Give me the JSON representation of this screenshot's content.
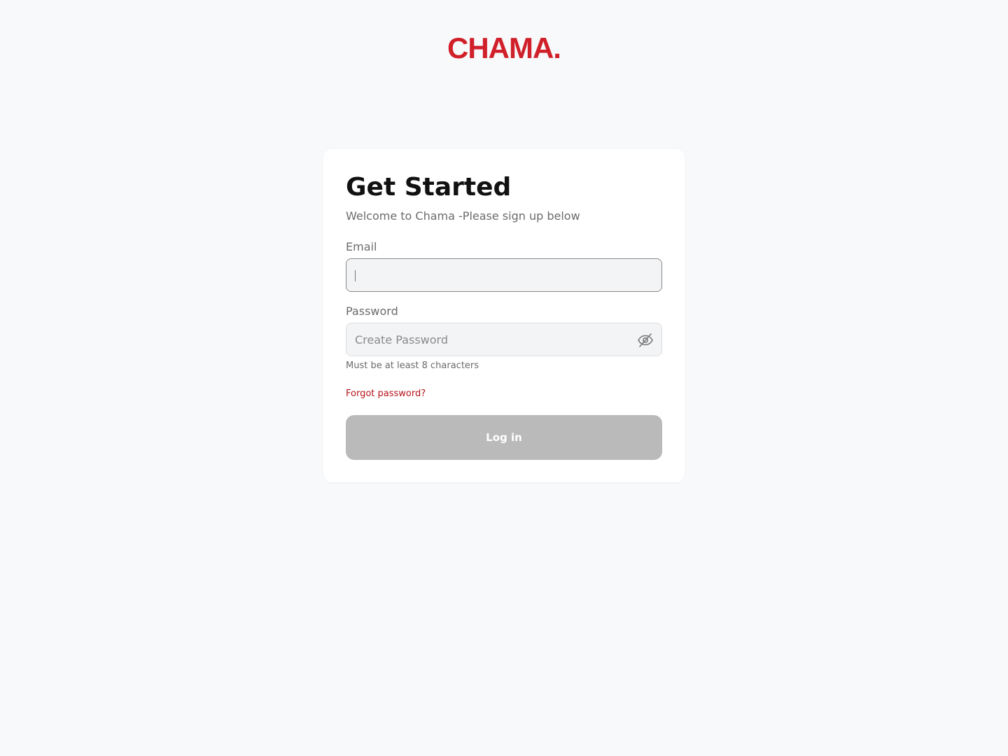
{
  "brand": {
    "logo_text": "CHAMA.",
    "color": "#d0202a"
  },
  "form": {
    "title": "Get Started",
    "subtitle": "Welcome to Chama -Please sign up below",
    "email": {
      "label": "Email",
      "value": "",
      "placeholder": ""
    },
    "password": {
      "label": "Password",
      "value": "",
      "placeholder": "Create Password",
      "toggle_icon": "eye-off-icon",
      "hint": "Must be at least 8 characters"
    },
    "forgot_label": "Forgot password?",
    "forgot_color": "#b5121b",
    "submit_label": "Log in",
    "submit_state": "disabled",
    "submit_color": "#bababa"
  }
}
